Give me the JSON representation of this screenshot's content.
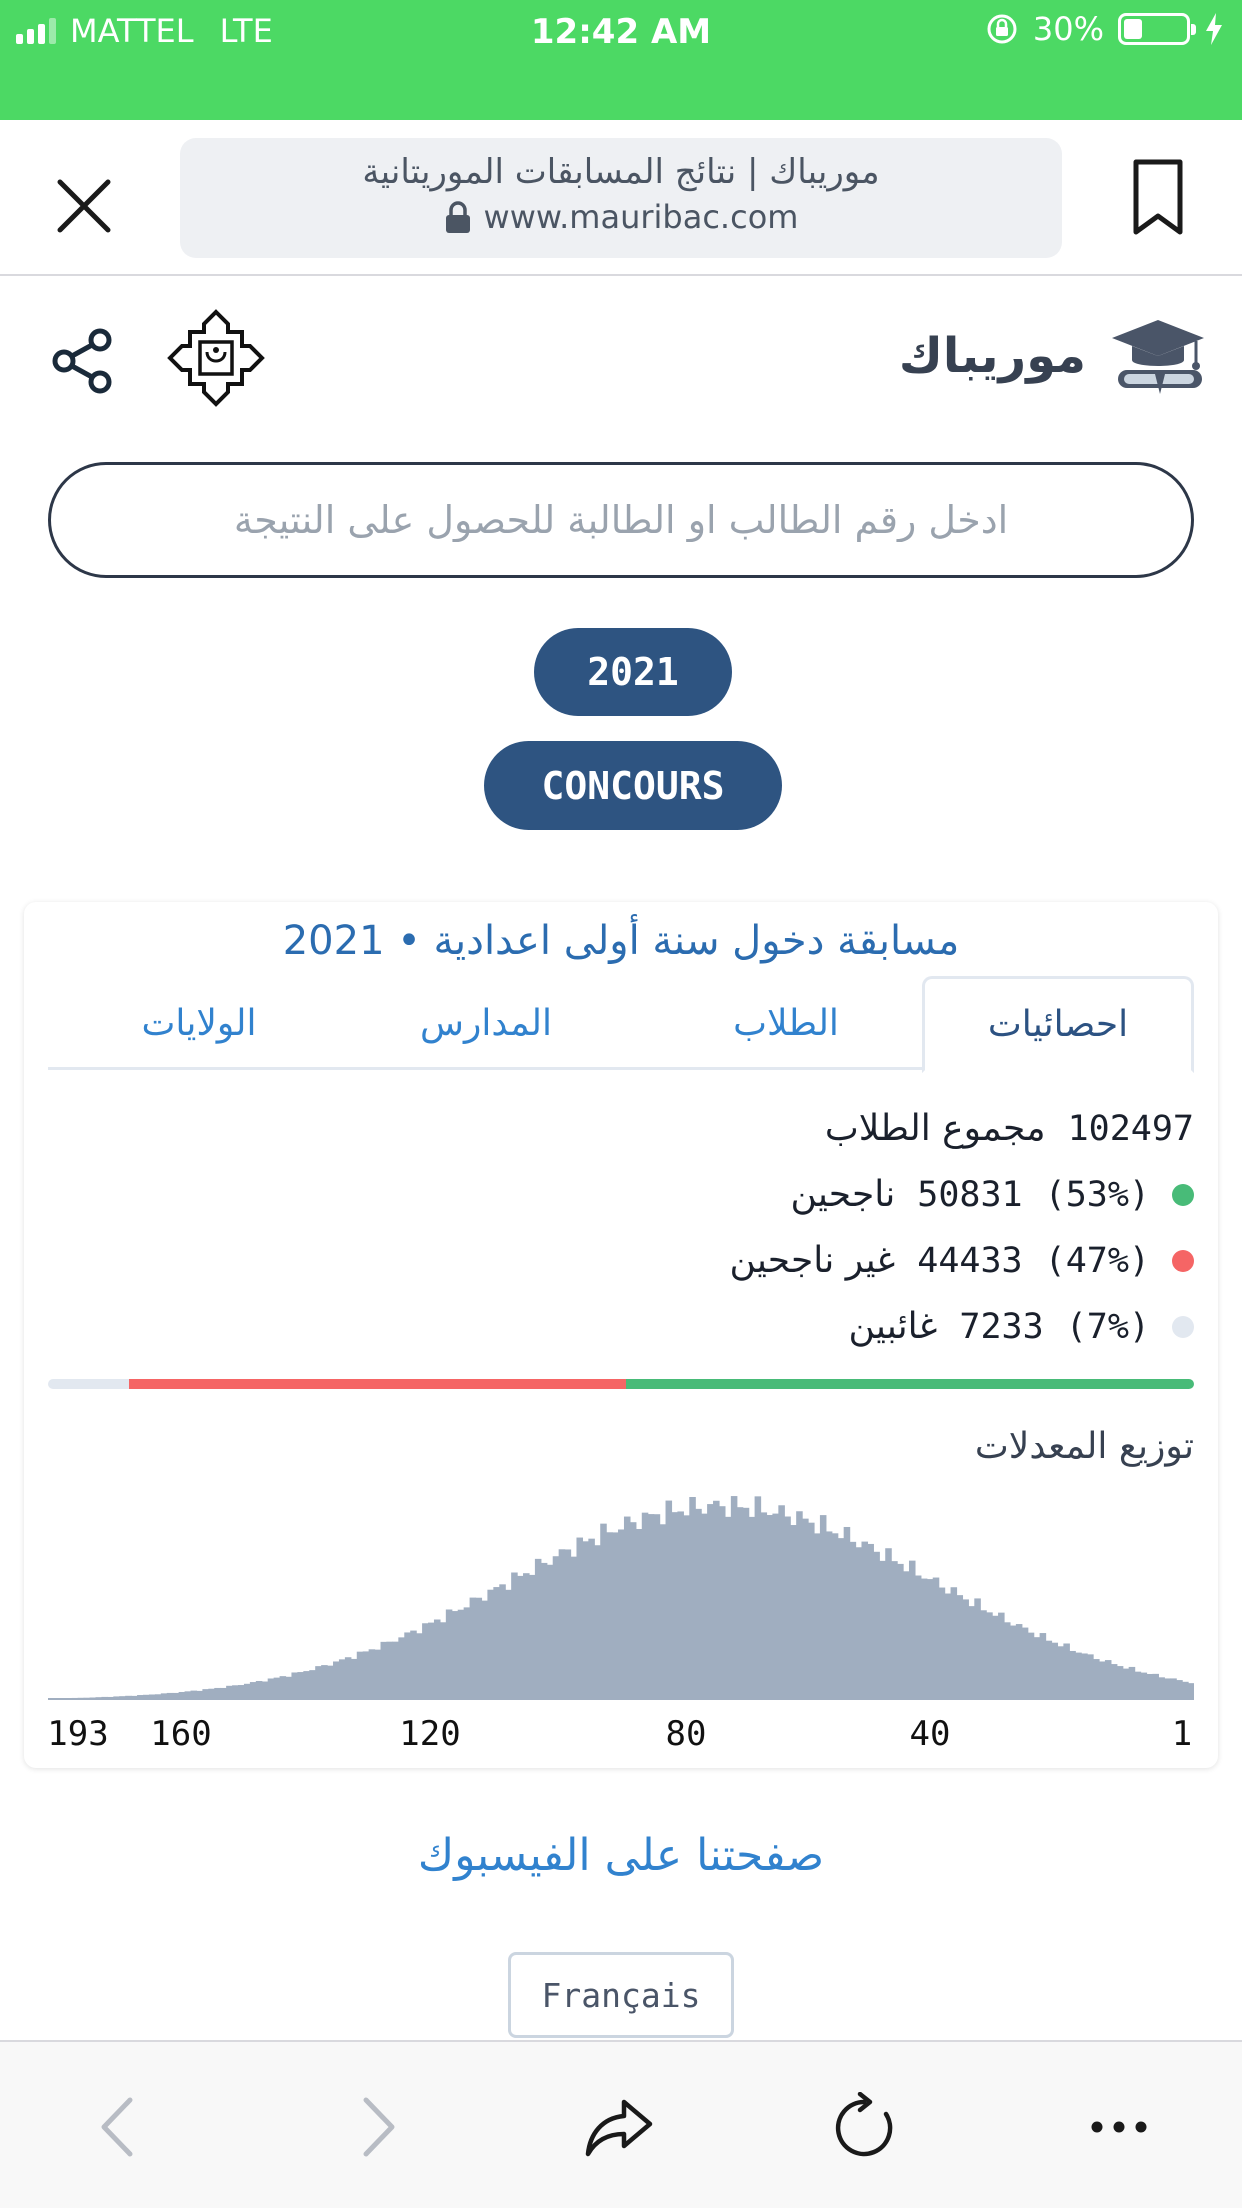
{
  "status_bar": {
    "carrier": "MATTEL",
    "network": "LTE",
    "time": "12:42 AM",
    "battery": "30%",
    "battery_level": 0.3
  },
  "address_bar": {
    "page_title": "موريباك | نتائج المسابقات الموريتانية",
    "url": "www.mauribac.com"
  },
  "site": {
    "brand_name": "موريباك",
    "search_placeholder": "ادخل رقم الطالب او الطالبة للحصول على النتيجة",
    "year_chip": "2021",
    "exam_chip": "CONCOURS"
  },
  "card": {
    "title": "مسابقة دخول سنة أولى اعدادية • 2021",
    "tabs": [
      {
        "label": "احصائيات",
        "active": true
      },
      {
        "label": "الطلاب",
        "active": false
      },
      {
        "label": "المدارس",
        "active": false
      },
      {
        "label": "الولايات",
        "active": false
      }
    ],
    "total": {
      "value": "102497",
      "label": "مجموع الطلاب"
    },
    "passed": {
      "pct": "(53%)",
      "value": "50831",
      "label": "ناجحين",
      "color": "#48bb78"
    },
    "failed": {
      "pct": "(47%)",
      "value": "44433",
      "label": "غير ناجحين",
      "color": "#f56565"
    },
    "absent": {
      "pct": "(7%)",
      "value": "7233",
      "label": "غائبين",
      "color": "#e2e8f0"
    },
    "distribution_title": "توزيع المعدلات",
    "histogram": {
      "color": "#a0aec0",
      "ticks": [
        "193",
        "160",
        "120",
        "80",
        "40",
        "1"
      ]
    }
  },
  "footer": {
    "facebook_link": "صفحتنا على الفيسبوك",
    "language_button": "Français"
  },
  "chart_data": {
    "type": "bar",
    "title": "توزيع المعدلات",
    "x_direction": "descending",
    "xlim": [
      193,
      1
    ],
    "ticks": [
      193,
      160,
      120,
      80,
      40,
      1
    ],
    "peak_rank": 80,
    "distribution_shape": "approximately normal, peak near 80"
  }
}
